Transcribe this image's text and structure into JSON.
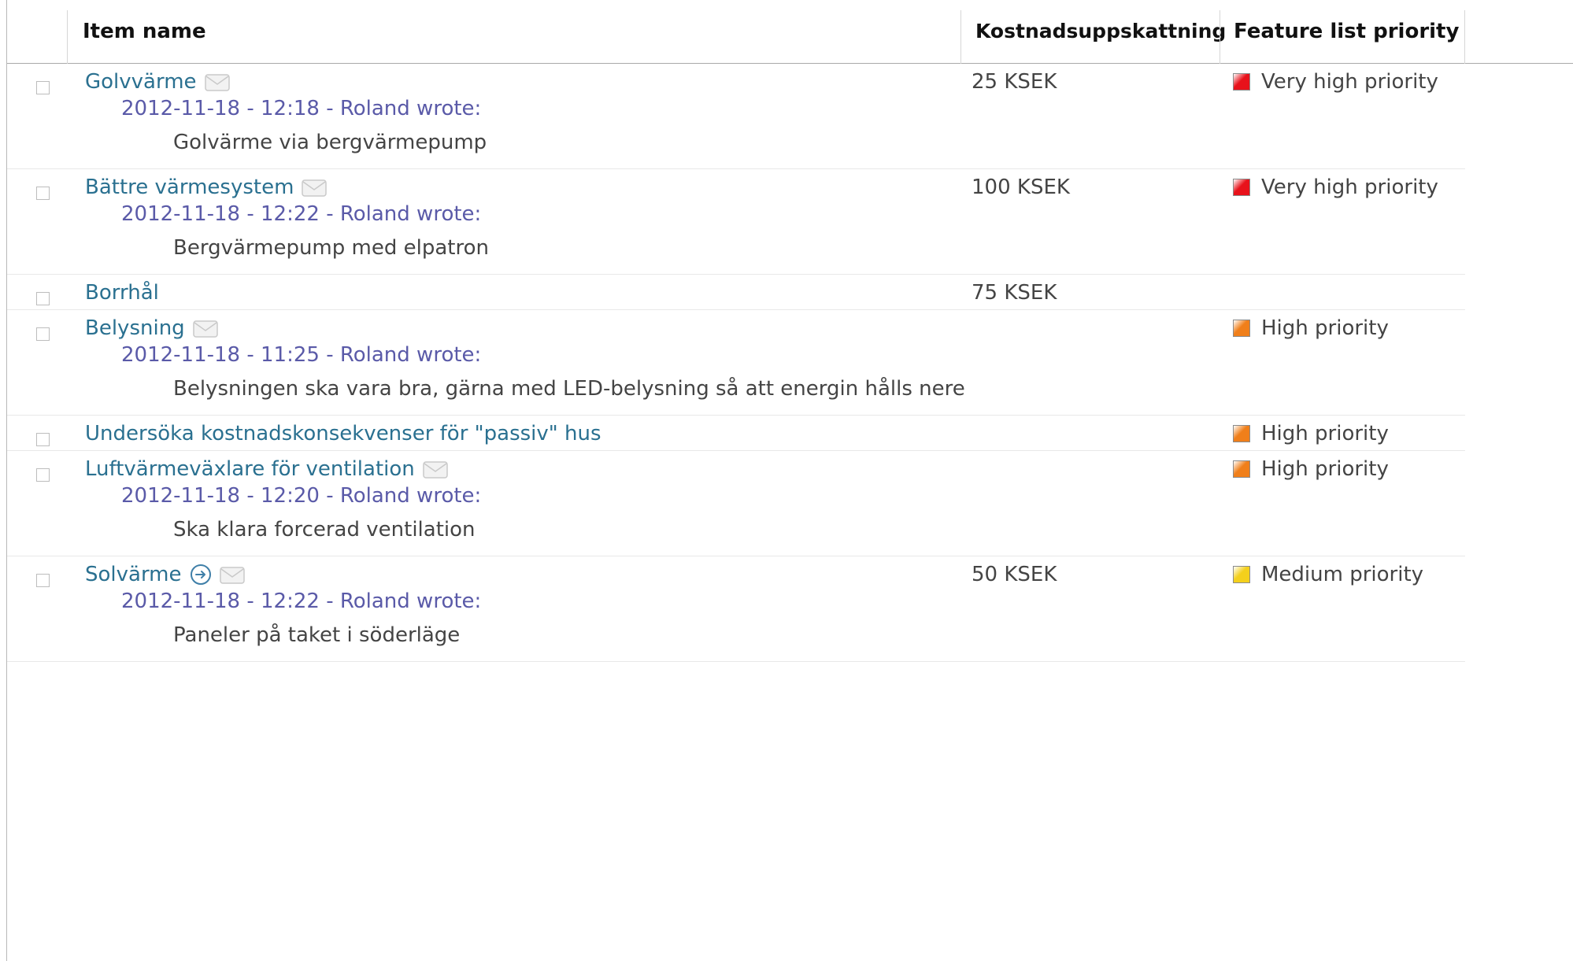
{
  "columns": {
    "item_name": "Item name",
    "cost": "Kostnadsuppskattning",
    "priority": "Feature list priority"
  },
  "colors": {
    "link": "#2a7090",
    "meta": "#5a5aa8",
    "very_high": "#e8121b",
    "high": "#f07f1a",
    "medium": "#f4d01c"
  },
  "rows": [
    {
      "title": "Golvvärme",
      "icons": [
        "envelope-icon"
      ],
      "cost": "25 KSEK",
      "priority": "Very high priority",
      "priority_level": "very_high",
      "meta": "2012-11-18 - 12:18 - Roland wrote:",
      "comment": "Golvärme via bergvärmepump"
    },
    {
      "title": "Bättre värmesystem",
      "icons": [
        "envelope-icon"
      ],
      "cost": "100 KSEK",
      "priority": "Very high priority",
      "priority_level": "very_high",
      "meta": "2012-11-18 - 12:22 - Roland wrote:",
      "comment": "Bergvärmepump med elpatron"
    },
    {
      "title": "Borrhål",
      "icons": [],
      "cost": "75 KSEK",
      "priority": "",
      "priority_level": "",
      "meta": "",
      "comment": ""
    },
    {
      "title": "Belysning",
      "icons": [
        "envelope-icon"
      ],
      "cost": "",
      "priority": "High priority",
      "priority_level": "high",
      "meta": "2012-11-18 - 11:25 - Roland wrote:",
      "comment": "Belysningen ska vara bra, gärna med LED-belysning så att energin hålls nere"
    },
    {
      "title": "Undersöka kostnadskonsekvenser för \"passiv\" hus",
      "icons": [],
      "cost": "",
      "priority": "High priority",
      "priority_level": "high",
      "meta": "",
      "comment": ""
    },
    {
      "title": "Luftvärmeväxlare för ventilation",
      "icons": [
        "envelope-icon"
      ],
      "cost": "",
      "priority": "High priority",
      "priority_level": "high",
      "meta": "2012-11-18 - 12:20 - Roland wrote:",
      "comment": "Ska klara forcerad ventilation"
    },
    {
      "title": "Solvärme",
      "icons": [
        "arrow-circle-icon",
        "envelope-icon"
      ],
      "cost": "50 KSEK",
      "priority": "Medium priority",
      "priority_level": "medium",
      "meta": "2012-11-18 - 12:22 - Roland wrote:",
      "comment": "Paneler på taket i söderläge"
    }
  ]
}
